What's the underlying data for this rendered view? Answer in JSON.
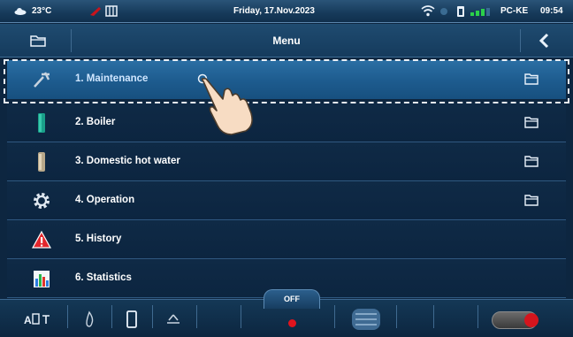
{
  "status_bar": {
    "temperature": "23°C",
    "date": "Friday, 17.Nov.2023",
    "device": "PC-KE",
    "time": "09:54"
  },
  "title_bar": {
    "title": "Menu",
    "left_icon": "folder-icon",
    "right_icon": "chevron-left-icon"
  },
  "menu": {
    "items": [
      {
        "label": "1. Maintenance",
        "icon": "wrench-icon",
        "has_folder": true,
        "selected": true
      },
      {
        "label": "2. Boiler",
        "icon": "boiler-icon",
        "has_folder": true,
        "selected": false
      },
      {
        "label": "3. Domestic hot water",
        "icon": "hot-water-tank-icon",
        "has_folder": true,
        "selected": false
      },
      {
        "label": "4. Operation",
        "icon": "gear-icon",
        "has_folder": true,
        "selected": false
      },
      {
        "label": "5. History",
        "icon": "warning-icon",
        "has_folder": false,
        "selected": false
      },
      {
        "label": "6. Statistics",
        "icon": "bar-chart-icon",
        "has_folder": false,
        "selected": false
      }
    ]
  },
  "bottom_bar": {
    "mode_label": "OFF",
    "icons": [
      "auto-mode-icon",
      "flame-icon",
      "tank-icon",
      "fan-icon",
      "stop-icon",
      "grid-icon",
      "power-toggle-icon"
    ]
  },
  "colors": {
    "selected_row": "#1d5b8e",
    "background": "#0d2640",
    "accent_red": "#d4151d"
  }
}
